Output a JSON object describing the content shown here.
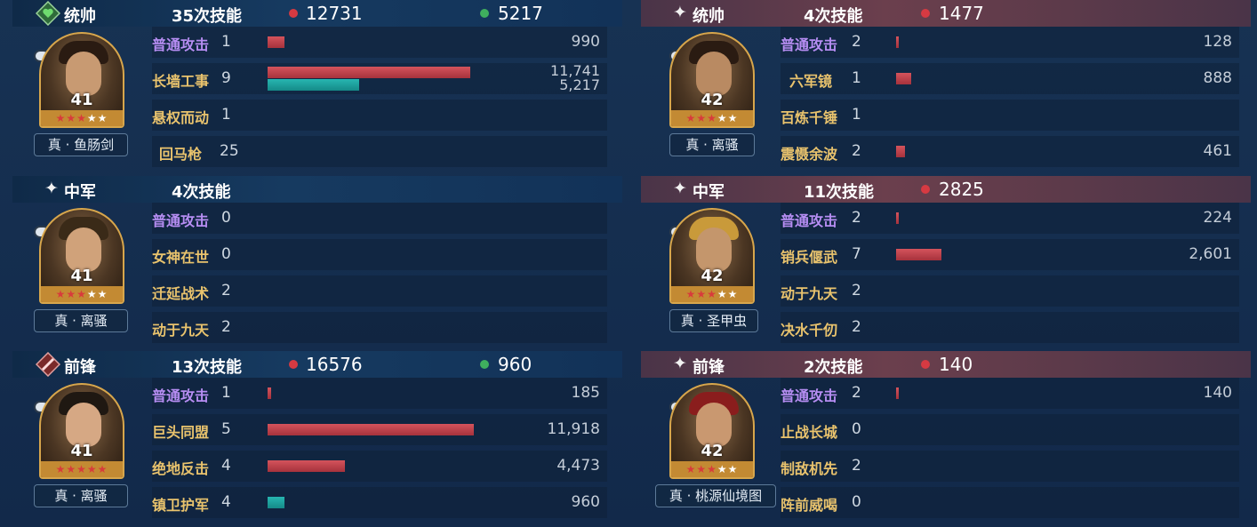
{
  "left": {
    "sections": [
      {
        "role": "统帅",
        "skill_count": "35次技能",
        "damage": "12731",
        "heal": "5217",
        "level": "41",
        "equipment": "真 · 鱼肠剑",
        "skills": [
          {
            "name": "普通攻击",
            "count": "1",
            "value": "990",
            "damage_ratio": 0.05
          },
          {
            "name": "长墙工事",
            "count": "9",
            "value": "11,741",
            "value2": "5,217",
            "damage_ratio": 0.6,
            "heal_ratio": 0.27
          },
          {
            "name": "悬权而动",
            "count": "1"
          },
          {
            "name": "回马枪",
            "count": "25"
          }
        ]
      },
      {
        "role": "中军",
        "skill_count": "4次技能",
        "level": "41",
        "equipment": "真 · 离骚",
        "skills": [
          {
            "name": "普通攻击",
            "count": "0"
          },
          {
            "name": "女神在世",
            "count": "0"
          },
          {
            "name": "迁延战术",
            "count": "2"
          },
          {
            "name": "动于九天",
            "count": "2"
          }
        ]
      },
      {
        "role": "前锋",
        "skill_count": "13次技能",
        "damage": "16576",
        "heal": "960",
        "level": "41",
        "equipment": "真 · 离骚",
        "skills": [
          {
            "name": "普通攻击",
            "count": "1",
            "value": "185",
            "damage_ratio": 0.01
          },
          {
            "name": "巨头同盟",
            "count": "5",
            "value": "11,918",
            "damage_ratio": 0.61
          },
          {
            "name": "绝地反击",
            "count": "4",
            "value": "4,473",
            "damage_ratio": 0.23
          },
          {
            "name": "镇卫护军",
            "count": "4",
            "value": "960",
            "heal_ratio": 0.05
          }
        ]
      }
    ]
  },
  "right": {
    "sections": [
      {
        "role": "统帅",
        "skill_count": "4次技能",
        "damage": "1477",
        "level": "42",
        "equipment": "真 · 离骚",
        "skills": [
          {
            "name": "普通攻击",
            "count": "2",
            "value": "128",
            "damage_ratio": 0.005
          },
          {
            "name": "六军镜",
            "count": "1",
            "value": "888",
            "damage_ratio": 0.045
          },
          {
            "name": "百炼千锤",
            "count": "1"
          },
          {
            "name": "震慑余波",
            "count": "2",
            "value": "461",
            "damage_ratio": 0.025
          }
        ]
      },
      {
        "role": "中军",
        "skill_count": "11次技能",
        "damage": "2825",
        "level": "42",
        "equipment": "真 · 圣甲虫",
        "skills": [
          {
            "name": "普通攻击",
            "count": "2",
            "value": "224",
            "damage_ratio": 0.005
          },
          {
            "name": "销兵偃武",
            "count": "7",
            "value": "2,601",
            "damage_ratio": 0.135
          },
          {
            "name": "动于九天",
            "count": "2"
          },
          {
            "name": "决水千仞",
            "count": "2"
          }
        ]
      },
      {
        "role": "前锋",
        "skill_count": "2次技能",
        "damage": "140",
        "level": "42",
        "equipment": "真 · 桃源仙境图",
        "skills": [
          {
            "name": "普通攻击",
            "count": "2",
            "value": "140",
            "damage_ratio": 0.005
          },
          {
            "name": "止战长城",
            "count": "0"
          },
          {
            "name": "制敌机先",
            "count": "2"
          },
          {
            "name": "阵前威喝",
            "count": "0"
          }
        ]
      }
    ]
  },
  "colors": {
    "damage": "#c5424b",
    "heal": "#1fa7a4",
    "basic_attack": "#b68df2",
    "skill_name": "#e9c36d"
  },
  "icons": {
    "commander": "green-heart-diamond-icon",
    "vanguard": "red-sword-diamond-icon",
    "sub": "sparkle-star-icon"
  }
}
